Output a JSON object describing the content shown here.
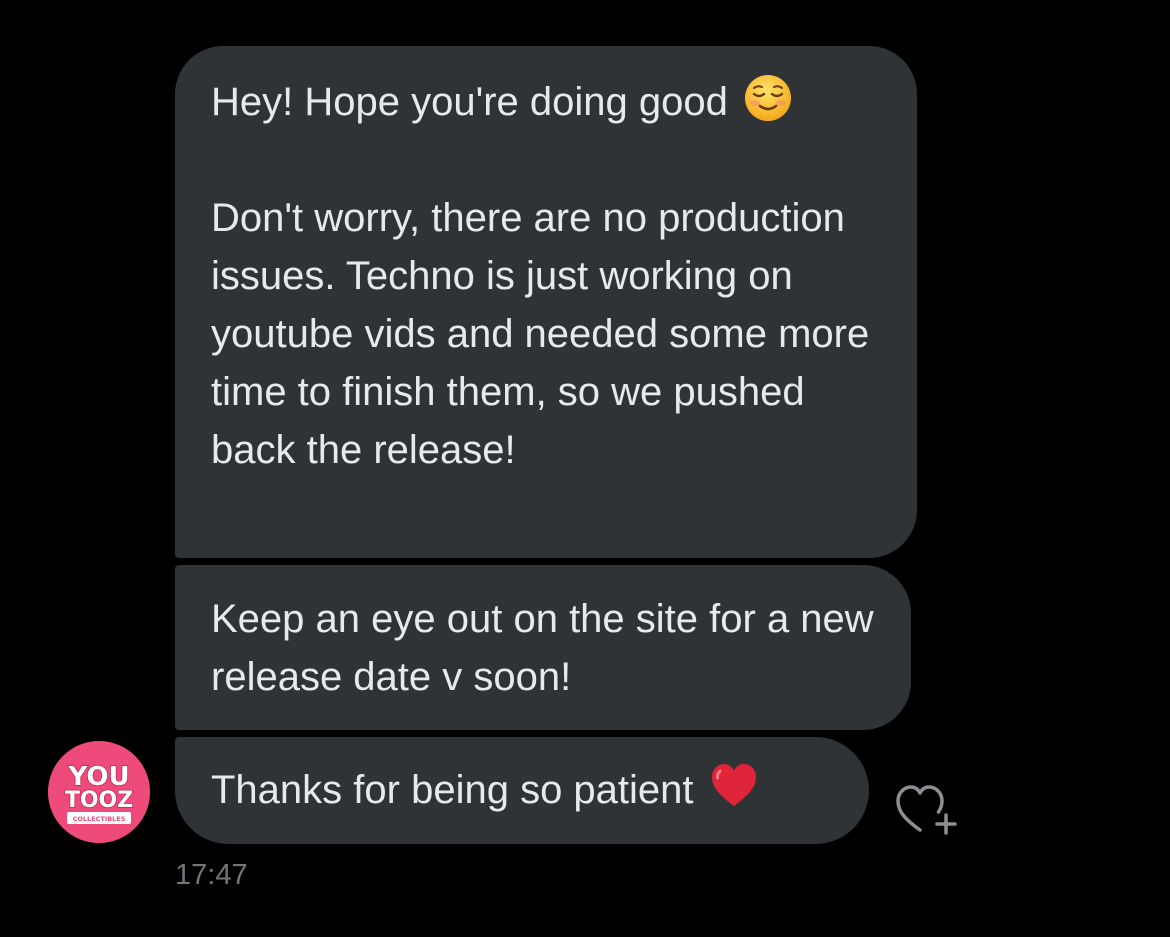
{
  "conversation": {
    "messages": [
      {
        "paragraph_1": "Hey! Hope you're doing good",
        "paragraph_1_emoji": "smiling-face-emoji",
        "paragraph_2": "Don't worry, there are no production issues. Techno is just working on youtube vids and needed some more time to finish them, so we pushed back the release!"
      },
      {
        "text": "Keep an eye out on the site for a new release date v soon!"
      },
      {
        "text": "Thanks for being so patient",
        "emoji": "red-heart-emoji"
      }
    ],
    "timestamp": "17:47",
    "sender_avatar": {
      "logo_line_1": "YOU",
      "logo_line_2": "TOOZ",
      "logo_tagline": "COLLECTIBLES",
      "background_color": "#ee4b7a"
    },
    "react_icon": "heart-plus-icon"
  },
  "colors": {
    "background": "#000000",
    "bubble": "#2f3336",
    "text": "#e7e9ea",
    "timestamp": "#71767b"
  }
}
